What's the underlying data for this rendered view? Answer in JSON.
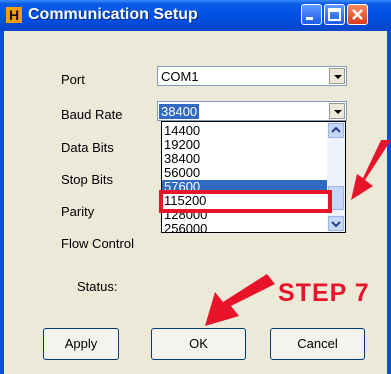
{
  "window": {
    "title": "Communication Setup",
    "app_icon_letter": "H"
  },
  "fields": {
    "port_label": "Port",
    "port_value": "COM1",
    "baud_label": "Baud Rate",
    "baud_value": "38400",
    "databits_label": "Data Bits",
    "stopbits_label": "Stop Bits",
    "parity_label": "Parity",
    "flow_label": "Flow Control",
    "status_label": "Status:"
  },
  "dropdown": {
    "options": [
      "14400",
      "19200",
      "38400",
      "56000",
      "57600",
      "115200",
      "128000",
      "256000"
    ],
    "highlighted": "57600"
  },
  "annotation": {
    "step_text": "STEP 7",
    "color": "#e8142a"
  },
  "buttons": {
    "apply": "Apply",
    "ok": "OK",
    "cancel": "Cancel"
  },
  "colors": {
    "title_bar": "#0050e4",
    "selection": "#316ac5",
    "dialog_bg": "#ece9d8"
  }
}
